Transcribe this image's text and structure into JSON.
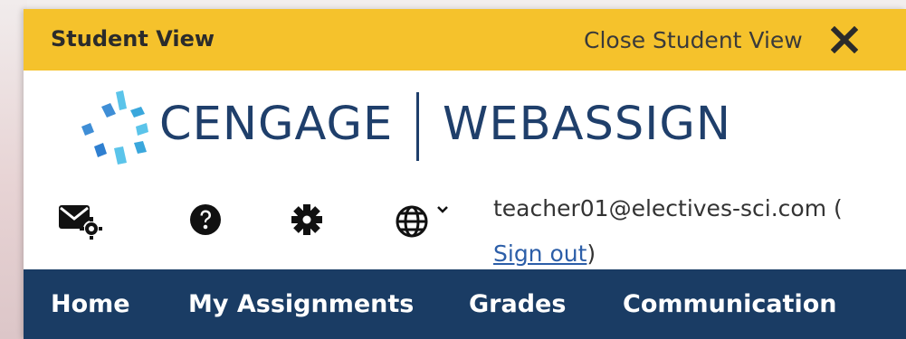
{
  "student_bar": {
    "title": "Student View",
    "close_label": "Close Student View",
    "close_icon": "close-icon"
  },
  "brand": {
    "cengage": "CENGAGE",
    "webassign": "WEBASSIGN"
  },
  "toolbar": {
    "icons": [
      "mail-settings-icon",
      "help-icon",
      "settings-icon",
      "globe-icon"
    ]
  },
  "account": {
    "email": "teacher01@electives-sci.com (",
    "sign_out": "Sign out",
    "close_paren": ")"
  },
  "nav": {
    "items": [
      {
        "label": "Home"
      },
      {
        "label": "My Assignments"
      },
      {
        "label": "Grades"
      },
      {
        "label": "Communication"
      }
    ]
  },
  "colors": {
    "student_bar_bg": "#f5c22c",
    "brand_navy": "#1f3f6b",
    "nav_bg": "#1a3c64",
    "link": "#2c5ea8"
  }
}
